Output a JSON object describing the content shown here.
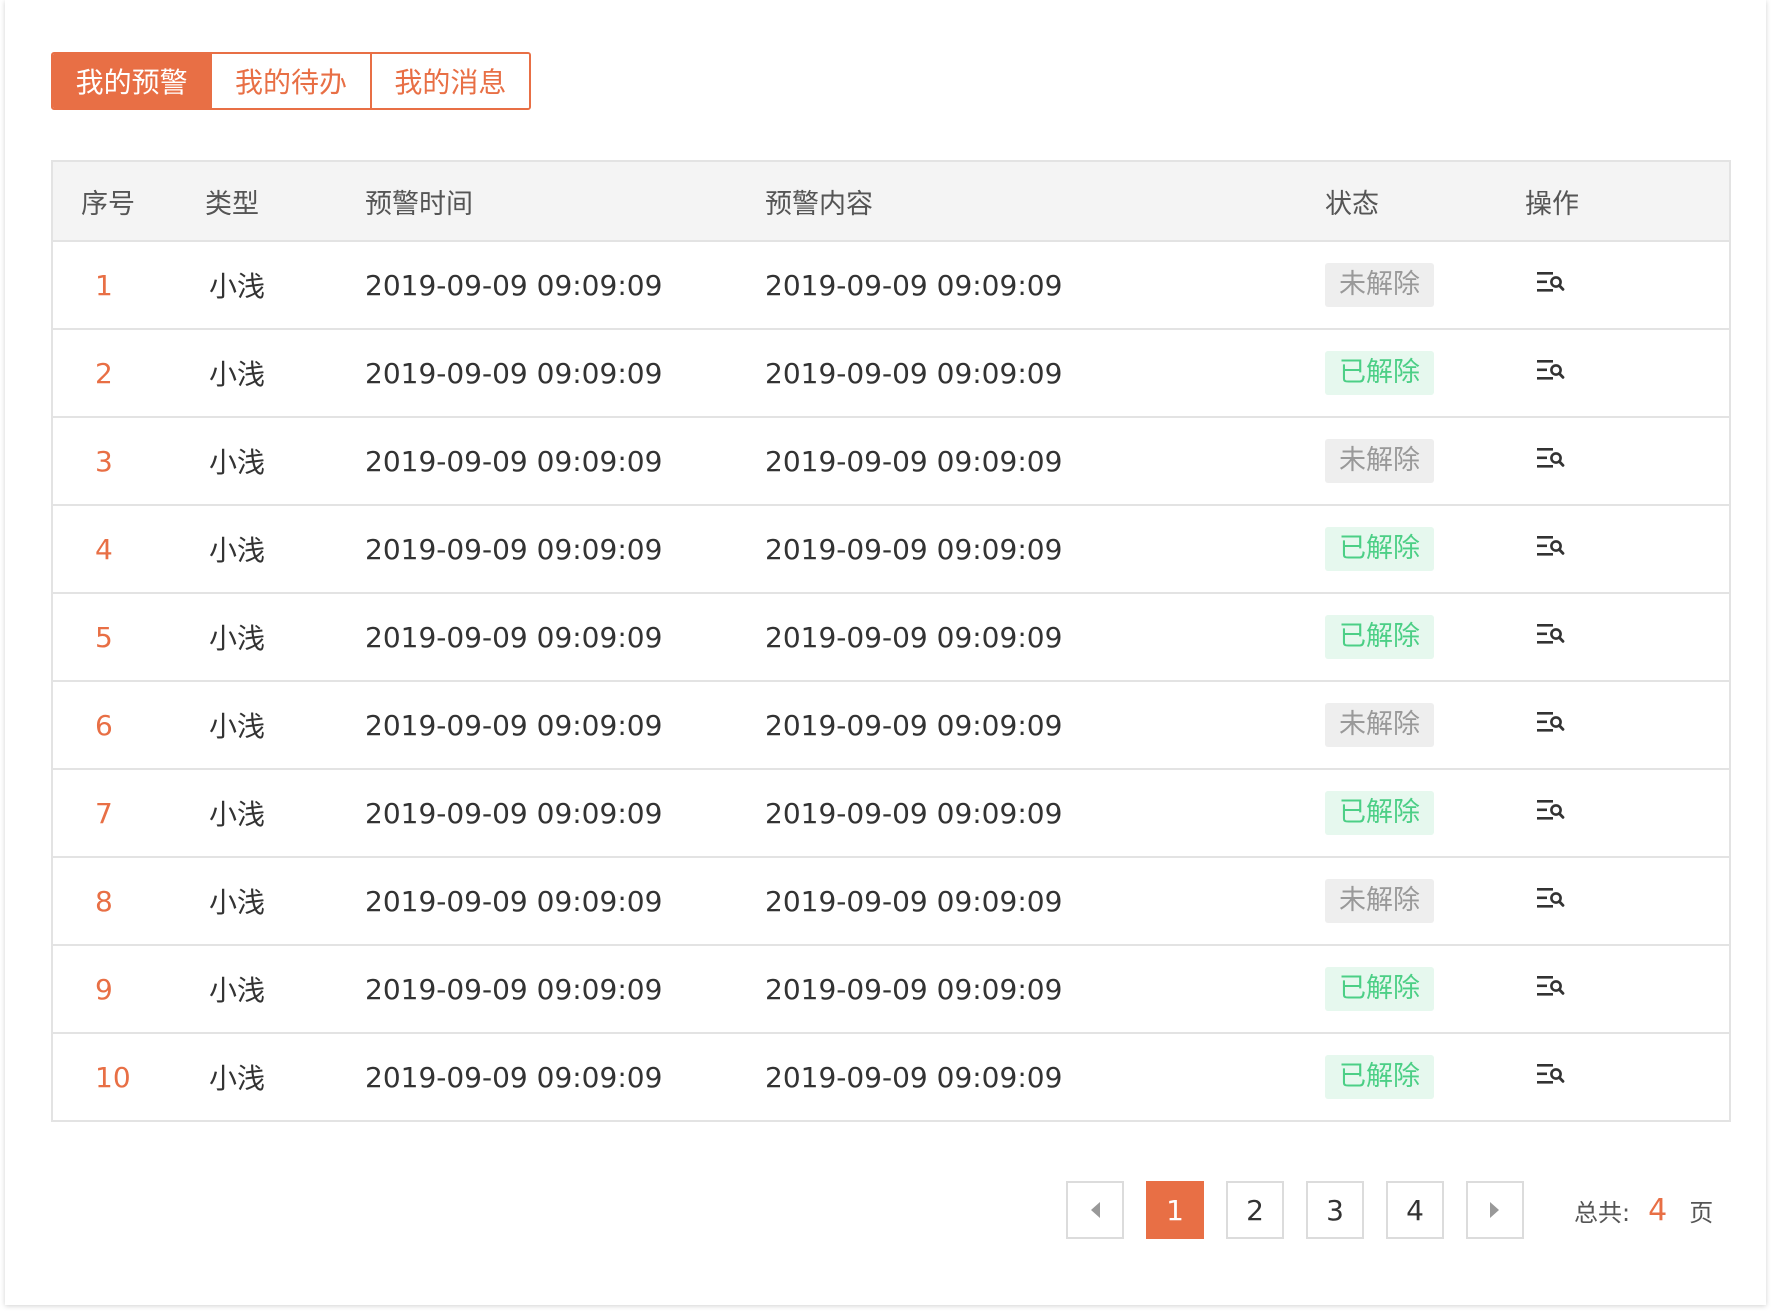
{
  "tabs": [
    {
      "label": "我的预警",
      "active": true
    },
    {
      "label": "我的待办",
      "active": false
    },
    {
      "label": "我的消息",
      "active": false
    }
  ],
  "table": {
    "headers": {
      "index": "序号",
      "type": "类型",
      "time": "预警时间",
      "content": "预警内容",
      "status": "状态",
      "action": "操作"
    },
    "rows": [
      {
        "index": "1",
        "type": "小浅",
        "time": "2019-09-09 09:09:09",
        "content": "2019-09-09 09:09:09",
        "status": "未解除"
      },
      {
        "index": "2",
        "type": "小浅",
        "time": "2019-09-09 09:09:09",
        "content": "2019-09-09 09:09:09",
        "status": "已解除"
      },
      {
        "index": "3",
        "type": "小浅",
        "time": "2019-09-09 09:09:09",
        "content": "2019-09-09 09:09:09",
        "status": "未解除"
      },
      {
        "index": "4",
        "type": "小浅",
        "time": "2019-09-09 09:09:09",
        "content": "2019-09-09 09:09:09",
        "status": "已解除"
      },
      {
        "index": "5",
        "type": "小浅",
        "time": "2019-09-09 09:09:09",
        "content": "2019-09-09 09:09:09",
        "status": "已解除"
      },
      {
        "index": "6",
        "type": "小浅",
        "time": "2019-09-09 09:09:09",
        "content": "2019-09-09 09:09:09",
        "status": "未解除"
      },
      {
        "index": "7",
        "type": "小浅",
        "time": "2019-09-09 09:09:09",
        "content": "2019-09-09 09:09:09",
        "status": "已解除"
      },
      {
        "index": "8",
        "type": "小浅",
        "time": "2019-09-09 09:09:09",
        "content": "2019-09-09 09:09:09",
        "status": "未解除"
      },
      {
        "index": "9",
        "type": "小浅",
        "time": "2019-09-09 09:09:09",
        "content": "2019-09-09 09:09:09",
        "status": "已解除"
      },
      {
        "index": "10",
        "type": "小浅",
        "time": "2019-09-09 09:09:09",
        "content": "2019-09-09 09:09:09",
        "status": "已解除"
      }
    ],
    "action_icon": "view-detail-icon"
  },
  "pagination": {
    "pages": [
      "1",
      "2",
      "3",
      "4"
    ],
    "current": "1",
    "total_label": "总共:",
    "total_pages": "4",
    "unit": "页",
    "prev_icon": "prev-arrow-icon",
    "next_icon": "next-arrow-icon"
  },
  "colors": {
    "accent": "#e86f45",
    "resolved_text": "#4ccf86",
    "resolved_bg": "#e6f8ee",
    "unresolved_text": "#999999",
    "unresolved_bg": "#eeeeee"
  }
}
